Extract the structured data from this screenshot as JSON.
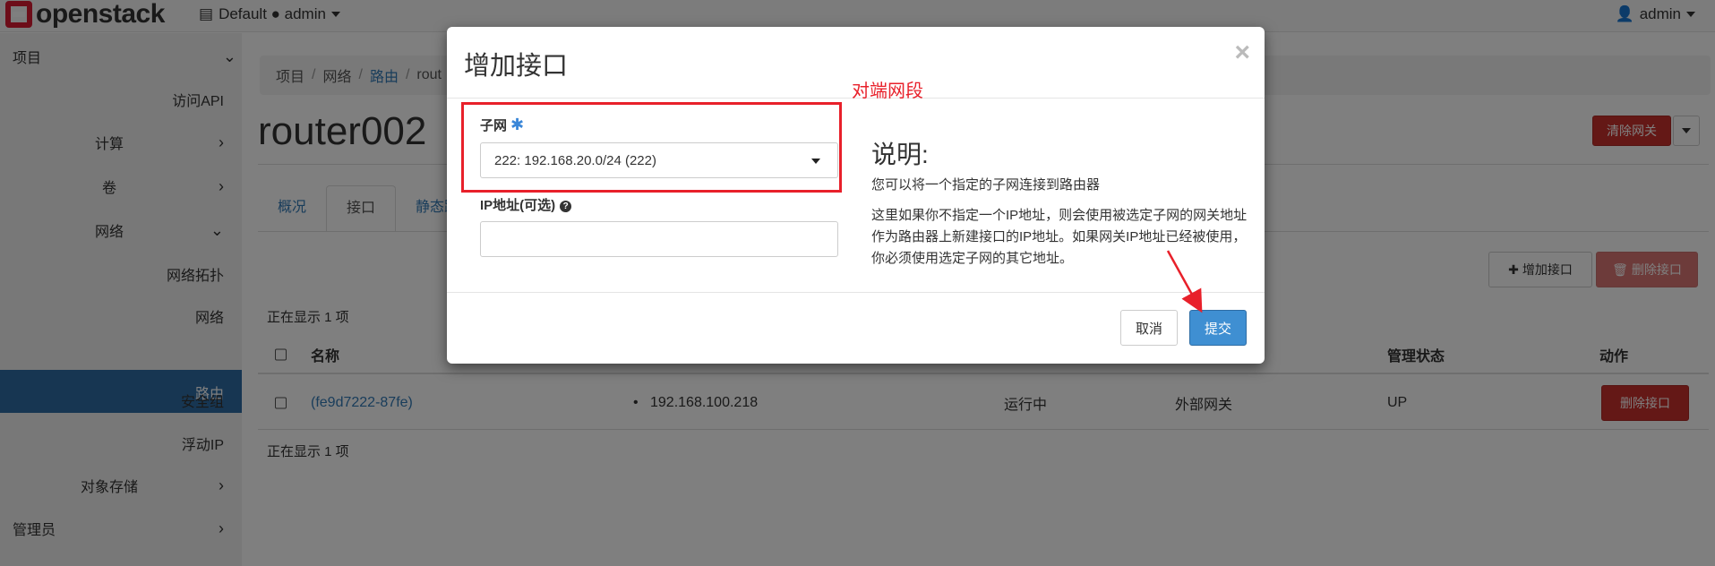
{
  "topbar": {
    "brand": "openstack",
    "project_picker": "Default ● admin",
    "user": "admin"
  },
  "sidebar": {
    "items": [
      {
        "label": "项目"
      },
      {
        "label": "访问API"
      },
      {
        "label": "计算"
      },
      {
        "label": "卷"
      },
      {
        "label": "网络"
      },
      {
        "label": "网络拓扑"
      },
      {
        "label": "网络"
      },
      {
        "label": "路由"
      },
      {
        "label": "安全组"
      },
      {
        "label": "浮动IP"
      },
      {
        "label": "对象存储"
      },
      {
        "label": "管理员"
      }
    ]
  },
  "breadcrumb": {
    "items": [
      "项目",
      "网络",
      "路由",
      "rout"
    ]
  },
  "page": {
    "title": "router002",
    "clear_gateway": "清除网关"
  },
  "tabs": [
    "概况",
    "接口",
    "静态路"
  ],
  "table": {
    "add_interface": "增加接口",
    "delete_interfaces": "删除接口",
    "showing_top": "正在显示 1 项",
    "showing_bottom": "正在显示 1 项",
    "headers": {
      "name": "名称",
      "admin_state": "管理状态",
      "actions": "动作"
    },
    "rows": [
      {
        "name": "(fe9d7222-87fe)",
        "ip": "192.168.100.218",
        "status": "运行中",
        "type": "外部网关",
        "admin_state": "UP",
        "action": "删除接口"
      }
    ]
  },
  "modal": {
    "title": "增加接口",
    "close": "×",
    "subnet_label": "子网",
    "subnet_value": "222: 192.168.20.0/24 (222)",
    "ip_label": "IP地址(可选)",
    "ip_value": "",
    "desc_title": "说明:",
    "desc_p1": "您可以将一个指定的子网连接到路由器",
    "desc_p2": "这里如果你不指定一个IP地址，则会使用被选定子网的网关地址作为路由器上新建接口的IP地址。如果网关IP地址已经被使用，你必须使用选定子网的其它地址。",
    "cancel": "取消",
    "submit": "提交"
  },
  "annotation": {
    "text": "对端网段",
    "color": "#e8202a"
  }
}
